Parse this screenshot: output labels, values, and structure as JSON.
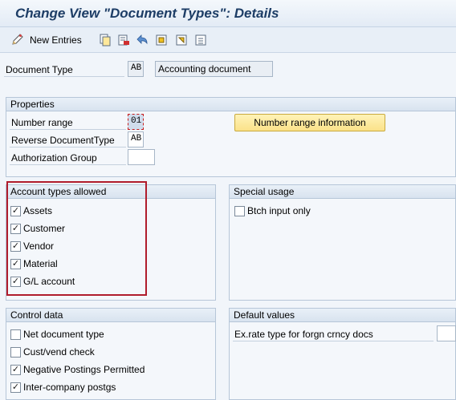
{
  "title": "Change View \"Document Types\": Details",
  "toolbar": {
    "new_entries_label": "New Entries"
  },
  "document_type": {
    "label": "Document Type",
    "code": "AB",
    "description": "Accounting document"
  },
  "properties": {
    "header": "Properties",
    "number_range_label": "Number range",
    "number_range_value": "01",
    "reverse_doc_type_label": "Reverse DocumentType",
    "reverse_doc_type_value": "AB",
    "authorization_group_label": "Authorization Group",
    "authorization_group_value": "",
    "number_range_info_button": "Number range information"
  },
  "account_types": {
    "header": "Account types allowed",
    "items": [
      {
        "label": "Assets",
        "checked": true
      },
      {
        "label": "Customer",
        "checked": true
      },
      {
        "label": "Vendor",
        "checked": true
      },
      {
        "label": "Material",
        "checked": true
      },
      {
        "label": "G/L account",
        "checked": true
      }
    ]
  },
  "special_usage": {
    "header": "Special usage",
    "items": [
      {
        "label": "Btch input only",
        "checked": false
      }
    ]
  },
  "control_data": {
    "header": "Control data",
    "items": [
      {
        "label": "Net document type",
        "checked": false
      },
      {
        "label": "Cust/vend check",
        "checked": false
      },
      {
        "label": "Negative Postings Permitted",
        "checked": true
      },
      {
        "label": "Inter-company postgs",
        "checked": true
      }
    ]
  },
  "default_values": {
    "header": "Default values",
    "exrate_label": "Ex.rate type for forgn crncy docs",
    "exrate_value": ""
  },
  "colors": {
    "title": "#1d3d66",
    "highlight_border": "#b01c2c",
    "button_bg": "#fbe289"
  }
}
